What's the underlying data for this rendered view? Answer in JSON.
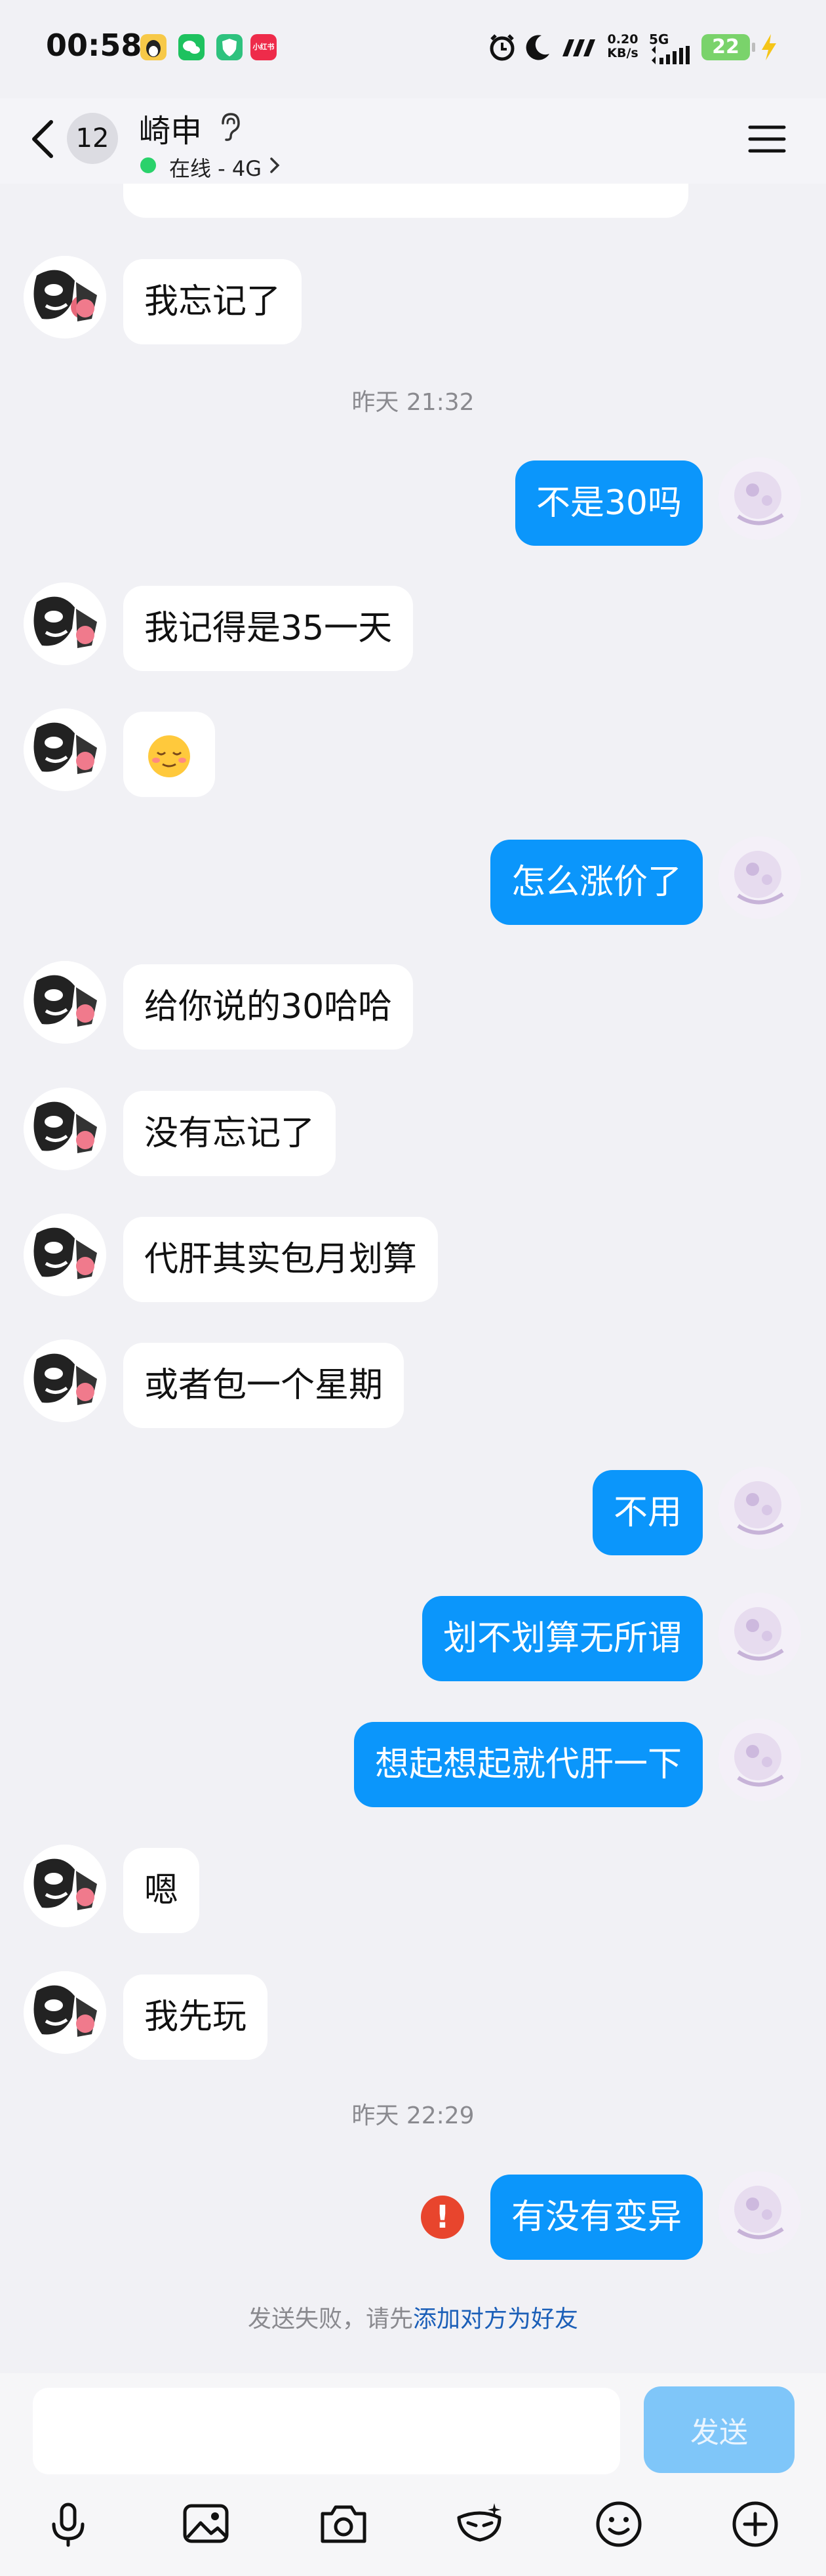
{
  "status_bar": {
    "time": "00:58",
    "apps": [
      {
        "name": "qq-icon",
        "color": "#f5c542"
      },
      {
        "name": "wechat-icon",
        "color": "#1ec25f"
      },
      {
        "name": "shield-app-icon",
        "color": "#2ec27e"
      },
      {
        "name": "xiaohongshu-icon",
        "color": "#ee2b4a",
        "label": "小红书"
      }
    ],
    "net_speed_value": "0.20",
    "net_speed_unit": "KB/s",
    "signal_label": "5G",
    "battery": "22"
  },
  "header": {
    "unread_count": "12",
    "contact_name": "崎申",
    "status": "在线 - 4G"
  },
  "messages": [
    {
      "side": "in",
      "text": "我忘记了"
    },
    {
      "type": "time",
      "text": "昨天 21:32"
    },
    {
      "side": "out",
      "text": "不是30吗"
    },
    {
      "side": "in",
      "text": "我记得是35一天"
    },
    {
      "side": "in",
      "emoji": "😌"
    },
    {
      "side": "out",
      "text": "怎么涨价了"
    },
    {
      "side": "in",
      "text": "给你说的30哈哈"
    },
    {
      "side": "in",
      "text": "没有忘记了"
    },
    {
      "side": "in",
      "text": "代肝其实包月划算"
    },
    {
      "side": "in",
      "text": "或者包一个星期"
    },
    {
      "side": "out",
      "text": "不用"
    },
    {
      "side": "out",
      "text": "划不划算无所谓"
    },
    {
      "side": "out",
      "text": "想起想起就代肝一下"
    },
    {
      "side": "in",
      "text": "嗯"
    },
    {
      "side": "in",
      "text": "我先玩"
    },
    {
      "type": "time",
      "text": "昨天 22:29"
    },
    {
      "side": "out",
      "text": "有没有变异",
      "failed": true
    }
  ],
  "fail_notice": {
    "prefix": "发送失败，请先",
    "link": "添加对方为好友"
  },
  "input": {
    "value": "",
    "placeholder": "",
    "send_label": "发送"
  },
  "toolbar": [
    "microphone-icon",
    "image-icon",
    "camera-icon",
    "mask-icon",
    "smile-icon",
    "plus-icon"
  ],
  "colors": {
    "outgoing_bubble": "#0b96fb",
    "incoming_bubble": "#ffffff",
    "background": "#f1f1f5",
    "send_button_disabled": "#7fc6f9",
    "error": "#e8452d",
    "link": "#1b5fb8"
  }
}
